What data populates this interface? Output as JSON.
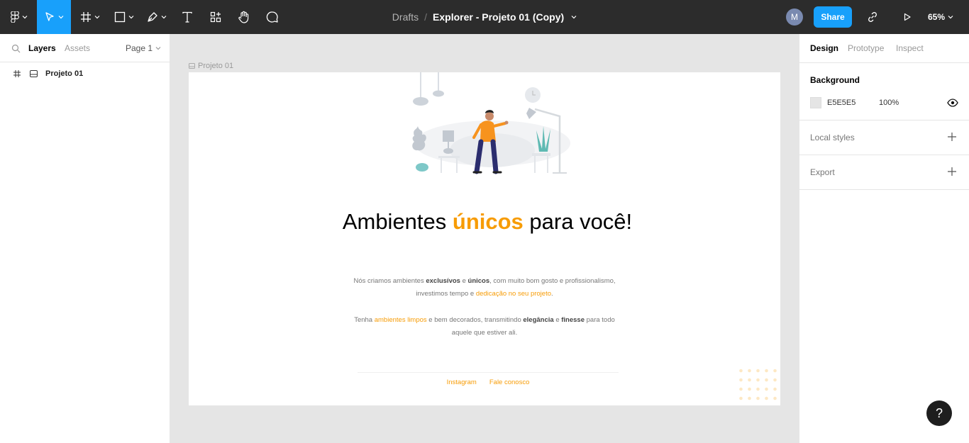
{
  "toolbar": {
    "tools": [
      "main-menu",
      "move-tool",
      "frame-tool",
      "shape-tool",
      "pen-tool",
      "text-tool",
      "resources-tool",
      "hand-tool",
      "comment-tool"
    ],
    "breadcrumb": {
      "folder": "Drafts",
      "separator": "/",
      "file": "Explorer - Projeto 01 (Copy)"
    },
    "avatar_initial": "M",
    "share_label": "Share",
    "zoom": "65%",
    "accent": "#18a0fb",
    "bg": "#2c2c2c"
  },
  "left_panel": {
    "tabs": {
      "layers": "Layers",
      "assets": "Assets"
    },
    "page": "Page 1",
    "layers": [
      {
        "name": "Projeto 01"
      }
    ]
  },
  "canvas": {
    "frame_label": "Projeto 01",
    "headline": {
      "before": "Ambientes ",
      "highlight": "únicos",
      "after": " para você!"
    },
    "paragraph1": {
      "t1": "Nós criamos ambientes ",
      "b1": "exclusívos",
      "t2": " e ",
      "b2": "únicos",
      "t3": ", com muito bom gosto e profissionalismo, investimos tempo e ",
      "o1": "dedicação no seu projeto",
      "t4": "."
    },
    "paragraph2": {
      "t1": "Tenha ",
      "o1": "ambientes limpos",
      "t2": " e bem decorados, transmitindo ",
      "b1": "elegância",
      "t3": "  e ",
      "b2": "finesse",
      "t4": " para todo aquele que estiver ali."
    },
    "links": [
      "Instagram",
      "Fale conosco"
    ],
    "accent": "#f79c06"
  },
  "right_panel": {
    "tabs": {
      "design": "Design",
      "prototype": "Prototype",
      "inspect": "Inspect"
    },
    "background": {
      "title": "Background",
      "hex": "E5E5E5",
      "opacity": "100%"
    },
    "local_styles": "Local styles",
    "export": "Export"
  },
  "help_label": "?"
}
